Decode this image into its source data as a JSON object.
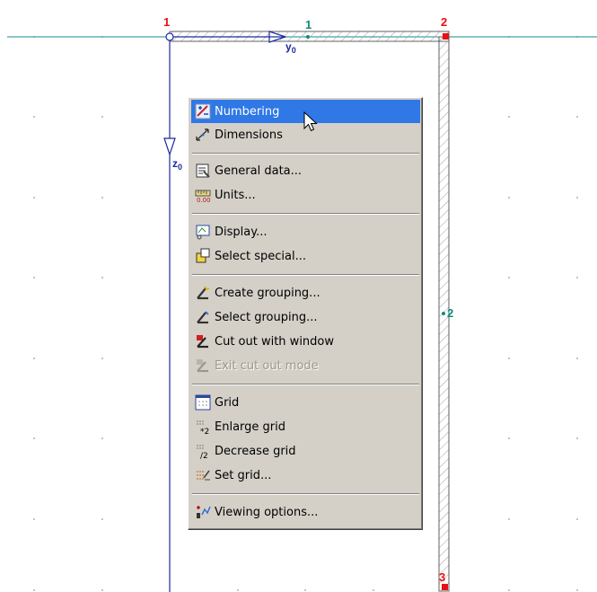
{
  "nodes": [
    {
      "label": "1",
      "color": "#e81010"
    },
    {
      "label": "2",
      "color": "#e81010"
    },
    {
      "label": "3",
      "color": "#e81010"
    }
  ],
  "elements": [
    {
      "label": "1",
      "color": "#118a7a"
    },
    {
      "label": "2",
      "color": "#118a7a"
    }
  ],
  "axes": {
    "y": {
      "letter": "y",
      "sub": "0"
    },
    "z": {
      "letter": "z",
      "sub": "0"
    }
  },
  "context_menu": {
    "items": [
      {
        "label": "Numbering",
        "icon": "numbering-icon",
        "state": "highlighted"
      },
      {
        "label": "Dimensions",
        "icon": "dimensions-icon",
        "state": "normal"
      },
      {
        "label": "General data...",
        "icon": "general-data-icon",
        "state": "normal"
      },
      {
        "label": "Units...",
        "icon": "units-icon",
        "state": "normal"
      },
      {
        "label": "Display...",
        "icon": "display-icon",
        "state": "normal"
      },
      {
        "label": "Select special...",
        "icon": "select-special-icon",
        "state": "normal"
      },
      {
        "label": "Create grouping...",
        "icon": "create-grouping-icon",
        "state": "normal"
      },
      {
        "label": "Select grouping...",
        "icon": "select-grouping-icon",
        "state": "normal"
      },
      {
        "label": "Cut out with window",
        "icon": "cut-out-window-icon",
        "state": "normal"
      },
      {
        "label": "Exit cut out mode",
        "icon": "exit-cut-out-icon",
        "state": "disabled"
      },
      {
        "label": "Grid",
        "icon": "grid-icon",
        "state": "normal"
      },
      {
        "label": "Enlarge grid",
        "icon": "enlarge-grid-icon",
        "state": "normal"
      },
      {
        "label": "Decrease grid",
        "icon": "decrease-grid-icon",
        "state": "normal"
      },
      {
        "label": "Set grid...",
        "icon": "set-grid-icon",
        "state": "normal"
      },
      {
        "label": "Viewing options...",
        "icon": "viewing-options-icon",
        "state": "normal"
      }
    ]
  },
  "colors": {
    "node": "#e81010",
    "element_label": "#118a7a",
    "axis": "#1c2aa0",
    "reference_line": "#1a8a8a",
    "menu_bg": "#d4d0c8",
    "menu_highlight": "#2f78e6"
  }
}
